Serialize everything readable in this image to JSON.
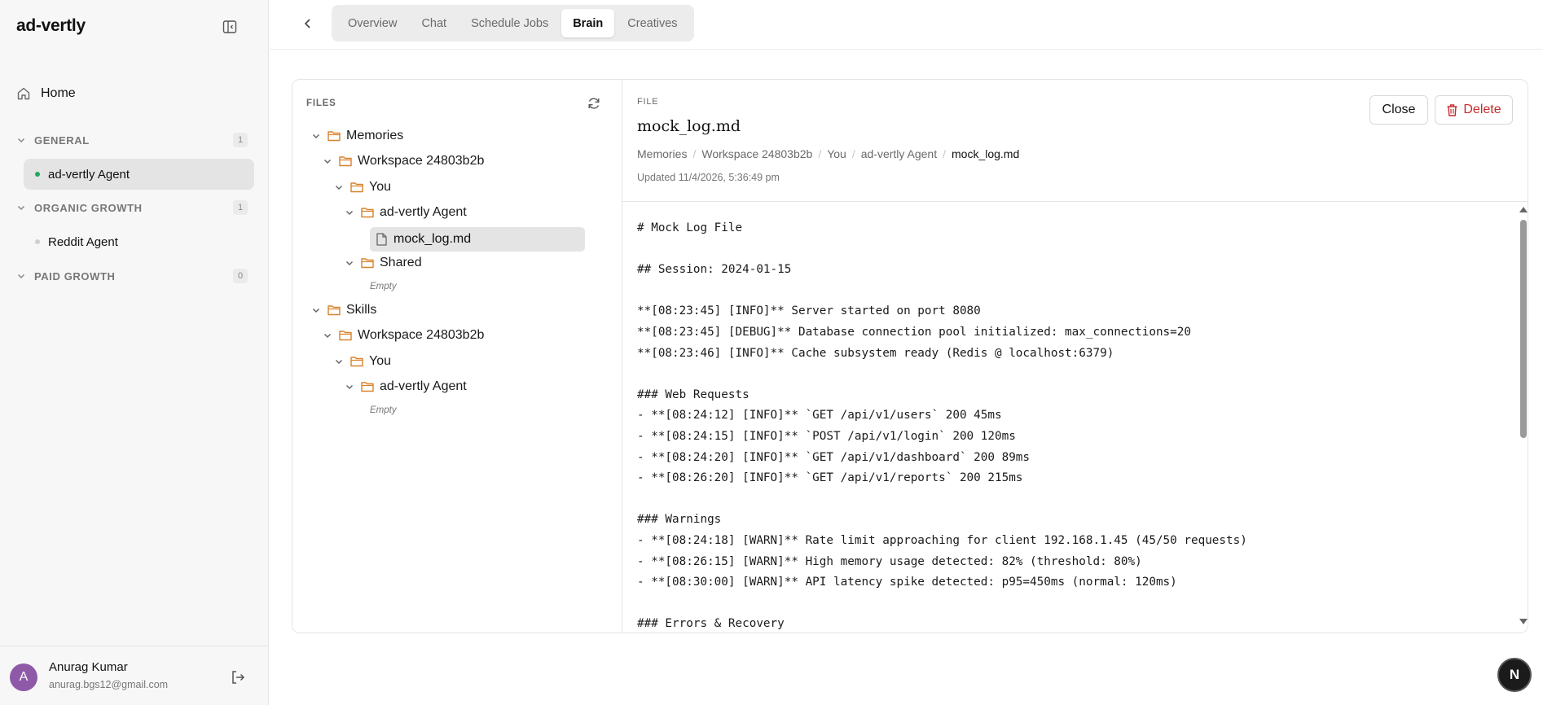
{
  "sidebar": {
    "brand": "ad-vertly",
    "home_label": "Home",
    "groups": [
      {
        "title": "GENERAL",
        "count": "1",
        "items": [
          {
            "label": "ad-vertly Agent",
            "status_color": "#22a861"
          }
        ]
      },
      {
        "title": "ORGANIC GROWTH",
        "count": "1",
        "items": [
          {
            "label": "Reddit Agent",
            "status_color": "#cfcfcf"
          }
        ]
      },
      {
        "title": "PAID GROWTH",
        "count": "0",
        "items": []
      }
    ],
    "user": {
      "initial": "A",
      "name": "Anurag Kumar",
      "email": "anurag.bgs12@gmail.com"
    }
  },
  "tabs": [
    "Overview",
    "Chat",
    "Schedule Jobs",
    "Brain",
    "Creatives"
  ],
  "active_tab": "Brain",
  "files": {
    "title": "FILES",
    "tree": {
      "memories": "Memories",
      "mem_workspace": "Workspace 24803b2b",
      "mem_you": "You",
      "mem_agent": "ad-vertly Agent",
      "mem_file": "mock_log.md",
      "mem_shared": "Shared",
      "mem_shared_empty": "Empty",
      "skills": "Skills",
      "sk_workspace": "Workspace 24803b2b",
      "sk_you": "You",
      "sk_agent": "ad-vertly Agent",
      "sk_agent_empty": "Empty"
    }
  },
  "detail": {
    "label": "FILE",
    "title": "mock_log.md",
    "breadcrumb": [
      "Memories",
      "Workspace 24803b2b",
      "You",
      "ad-vertly Agent",
      "mock_log.md"
    ],
    "updated": "Updated 11/4/2026, 5:36:49 pm",
    "close_label": "Close",
    "delete_label": "Delete",
    "content_lines": [
      "# Mock Log File",
      "",
      "## Session: 2024-01-15",
      "",
      "**[08:23:45] [INFO]** Server started on port 8080",
      "**[08:23:45] [DEBUG]** Database connection pool initialized: max_connections=20",
      "**[08:23:46] [INFO]** Cache subsystem ready (Redis @ localhost:6379)",
      "",
      "### Web Requests",
      "- **[08:24:12] [INFO]** `GET /api/v1/users` 200 45ms",
      "- **[08:24:15] [INFO]** `POST /api/v1/login` 200 120ms",
      "- **[08:24:20] [INFO]** `GET /api/v1/dashboard` 200 89ms",
      "- **[08:26:20] [INFO]** `GET /api/v1/reports` 200 215ms",
      "",
      "### Warnings",
      "- **[08:24:18] [WARN]** Rate limit approaching for client 192.168.1.45 (45/50 requests)",
      "- **[08:26:15] [WARN]** High memory usage detected: 82% (threshold: 80%)",
      "- **[08:30:00] [WARN]** API latency spike detected: p95=450ms (normal: 120ms)",
      "",
      "### Errors & Recovery"
    ]
  },
  "fab_label": "N"
}
